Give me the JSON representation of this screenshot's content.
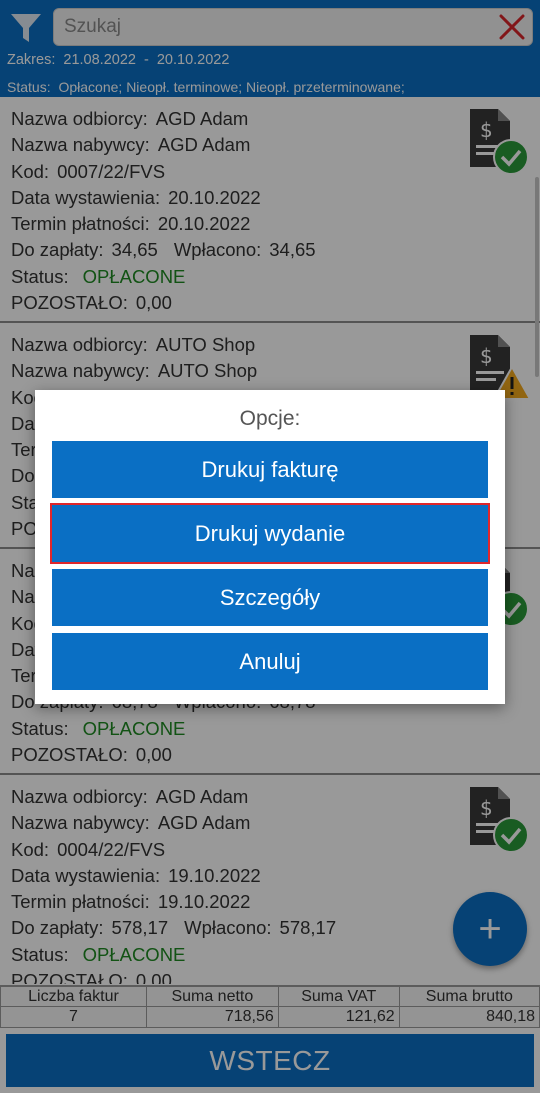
{
  "header": {
    "search_placeholder": "Szukaj",
    "range_label": "Zakres:",
    "range_from": "21.08.2022",
    "range_dash": "-",
    "range_to": "20.10.2022",
    "status_label": "Status:",
    "status_value": "Opłacone; Nieopł. terminowe; Nieopł. przeterminowane;"
  },
  "labels": {
    "recipient": "Nazwa odbiorcy:",
    "buyer": "Nazwa nabywcy:",
    "code": "Kod:",
    "issue_date": "Data wystawienia:",
    "due_date": "Termin płatności:",
    "to_pay": "Do zapłaty:",
    "paid": "Wpłacono:",
    "status": "Status:",
    "remaining": "POZOSTAŁO:"
  },
  "invoices": [
    {
      "recipient": "AGD Adam",
      "buyer": "AGD Adam",
      "code": "0007/22/FVS",
      "issue_date": "20.10.2022",
      "due_date": "20.10.2022",
      "to_pay": "34,65",
      "paid": "34,65",
      "status": "OPŁACONE",
      "remaining": "0,00",
      "icon": "invoice-paid-icon"
    },
    {
      "recipient": "AUTO Shop",
      "buyer": "AUTO Shop",
      "code": "",
      "issue_date": "",
      "due_date": "",
      "to_pay": "",
      "paid": "",
      "status": "",
      "remaining": "",
      "icon": "invoice-warning-icon"
    },
    {
      "recipient": "",
      "buyer": "",
      "code": "",
      "issue_date": "",
      "due_date": "",
      "to_pay": "68,78",
      "paid": "68,78",
      "status": "OPŁACONE",
      "remaining": "0,00",
      "icon": "invoice-paid-icon"
    },
    {
      "recipient": "AGD Adam",
      "buyer": "AGD Adam",
      "code": "0004/22/FVS",
      "issue_date": "19.10.2022",
      "due_date": "19.10.2022",
      "to_pay": "578,17",
      "paid": "578,17",
      "status": "OPŁACONE",
      "remaining": "0,00",
      "icon": "invoice-paid-icon"
    }
  ],
  "summary": {
    "headers": [
      "Liczba faktur",
      "Suma netto",
      "Suma VAT",
      "Suma brutto"
    ],
    "values": [
      "7",
      "718,56",
      "121,62",
      "840,18"
    ]
  },
  "back_label": "WSTECZ",
  "fab_label": "+",
  "dialog": {
    "title": "Opcje:",
    "buttons": [
      "Drukuj fakturę",
      "Drukuj wydanie",
      "Szczegóły",
      "Anuluj"
    ],
    "selected_index": 1
  },
  "colors": {
    "primary": "#0a6fc4",
    "paid_green": "#1e8a22",
    "warning": "#f2a81d",
    "clear_red": "#d9262b",
    "selection_outline": "#e0262b"
  }
}
